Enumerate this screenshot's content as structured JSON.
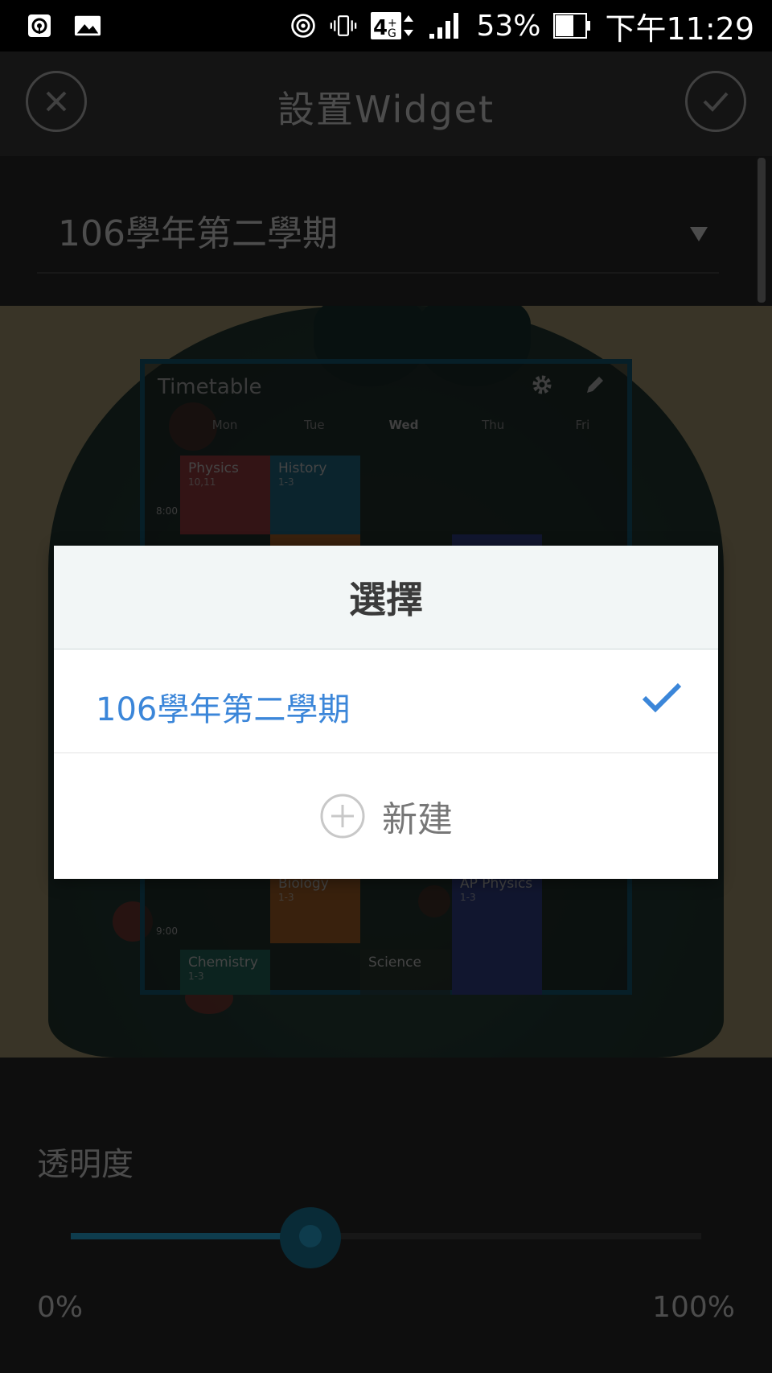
{
  "status_bar": {
    "icons_left": [
      "hotspot-icon",
      "image-icon"
    ],
    "icons_right": [
      "wifi-hotspot-icon",
      "vibrate-icon",
      "network-4g-icon",
      "signal-icon",
      "battery-icon"
    ],
    "network": "4G",
    "battery": "53%",
    "time": "下午11:29"
  },
  "app_bar": {
    "title": "設置Widget",
    "close_icon": "close-icon",
    "confirm_icon": "check-icon"
  },
  "semester_select": {
    "value": "106學年第二學期"
  },
  "widget_preview": {
    "title": "Timetable",
    "days": [
      "Mon",
      "Tue",
      "Wed",
      "Thu",
      "Fri"
    ],
    "today": "Wed",
    "times": [
      "8:00",
      "9:00"
    ],
    "cells": [
      {
        "name": "Physics",
        "detail": "10,11"
      },
      {
        "name": "History",
        "detail": "1-3"
      },
      {
        "name": "Biology",
        "detail": "1-3"
      },
      {
        "name": "AP Physics",
        "detail": "1-3"
      },
      {
        "name": "Chemistry",
        "detail": "1-3"
      },
      {
        "name": "Science",
        "detail": ""
      }
    ]
  },
  "opacity": {
    "label": "透明度",
    "min": "0%",
    "max": "100%",
    "value_fraction": 0.38
  },
  "dialog": {
    "title": "選擇",
    "items": [
      {
        "label": "106學年第二學期",
        "selected": true
      }
    ],
    "new_label": "新建"
  },
  "colors": {
    "accent": "#1b6d8c",
    "selected_text": "#3b86d9",
    "physics": "#b2474c",
    "history": "#2a7fa0",
    "biology": "#c9762f",
    "ap_physics": "#3e4fa7",
    "chemistry": "#2c7d6e"
  }
}
